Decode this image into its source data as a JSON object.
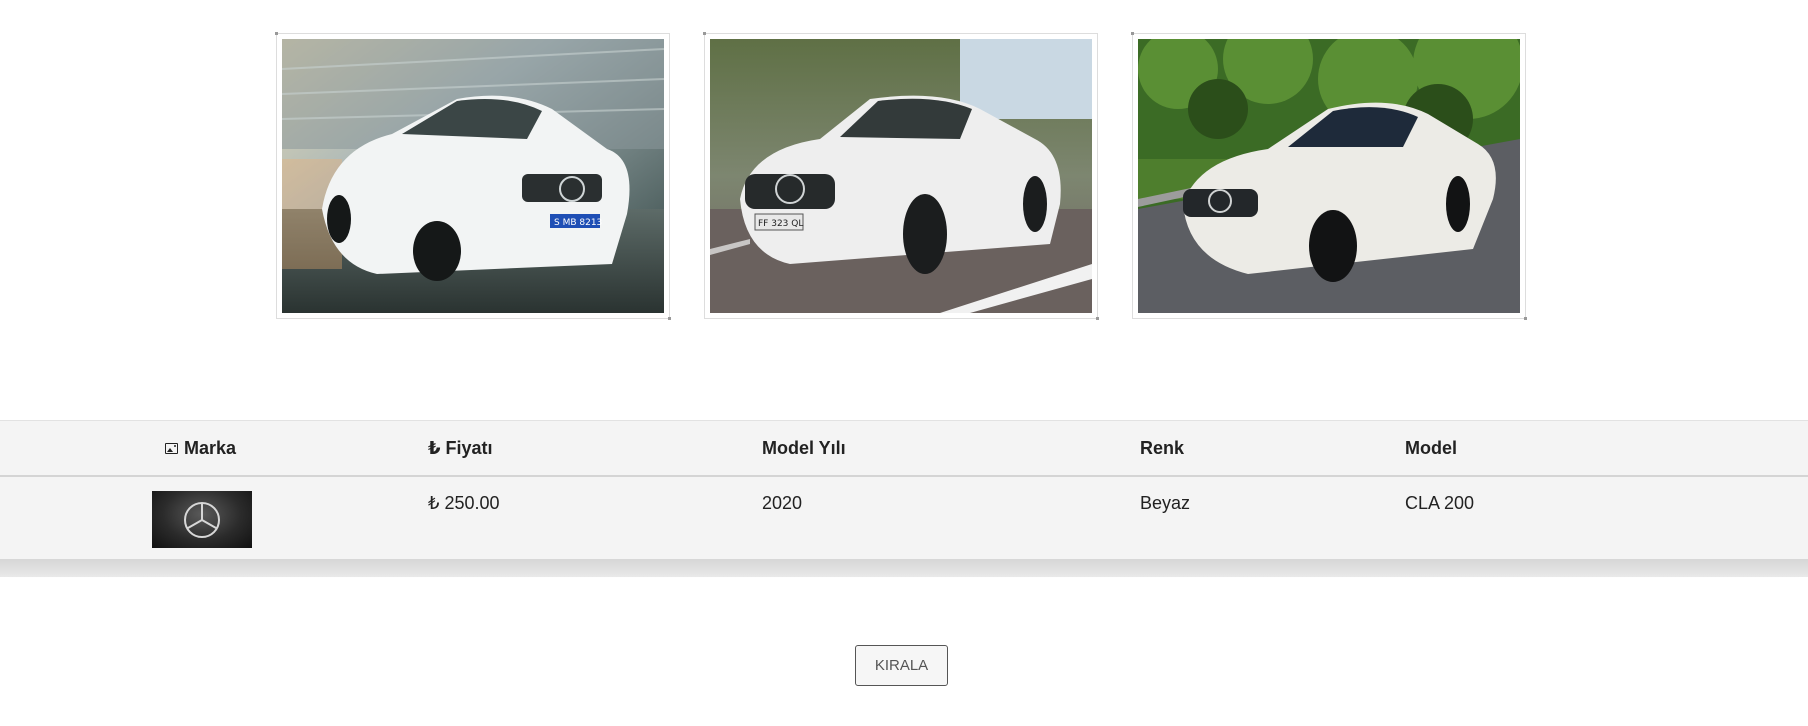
{
  "gallery": {
    "images": [
      {
        "alt": "Mercedes CLA white car on race track",
        "plate": "S MB 8213"
      },
      {
        "alt": "Mercedes CLA white car on road",
        "plate": "FF 323 QL"
      },
      {
        "alt": "Mercedes CLA white car parked"
      }
    ]
  },
  "table": {
    "headers": {
      "brand": "Marka",
      "price": "₺ Fiyatı",
      "year": "Model Yılı",
      "color": "Renk",
      "model": "Model"
    },
    "rows": [
      {
        "brand_logo": "mercedes-benz-logo",
        "price": "₺ 250.00",
        "year": "2020",
        "color": "Beyaz",
        "model": "CLA 200"
      }
    ]
  },
  "actions": {
    "rent_label": "KIRALA"
  }
}
